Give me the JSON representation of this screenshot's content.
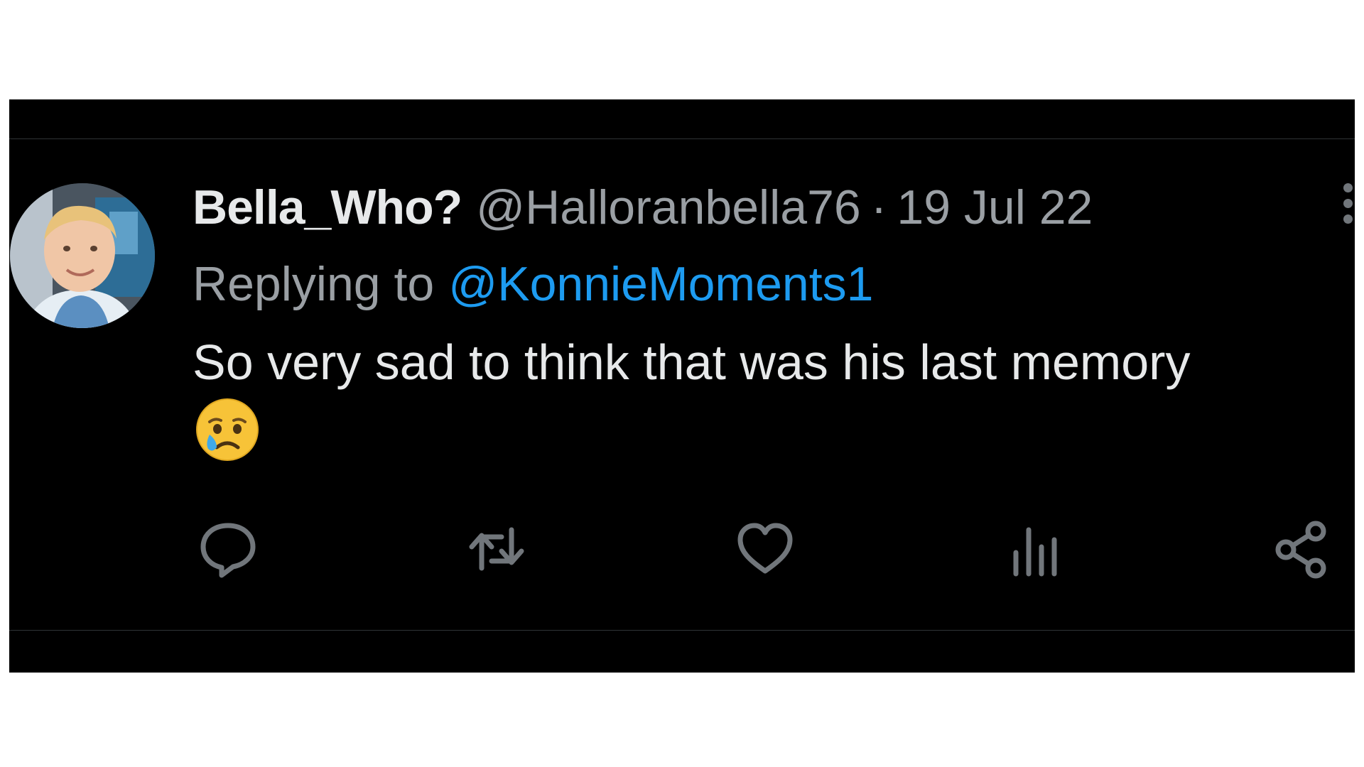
{
  "tweet": {
    "display_name": "Bella_Who?",
    "handle": "@Halloranbella76",
    "separator": "·",
    "date": "19 Jul 22",
    "reply_prefix": "Replying to",
    "reply_mention": "@KonnieMoments1",
    "text": "So very sad to think that was his last memory",
    "emoji": "crying-face",
    "colors": {
      "background": "#000000",
      "primary_text": "#e7e9ea",
      "secondary_text": "#71767b",
      "mention": "#1d9bf0",
      "divider": "#2f3336"
    }
  },
  "actions": [
    {
      "name": "reply",
      "icon": "speech-bubble-icon"
    },
    {
      "name": "retweet",
      "icon": "retweet-icon"
    },
    {
      "name": "like",
      "icon": "heart-icon"
    },
    {
      "name": "views",
      "icon": "bar-chart-icon"
    },
    {
      "name": "share",
      "icon": "share-icon"
    }
  ]
}
